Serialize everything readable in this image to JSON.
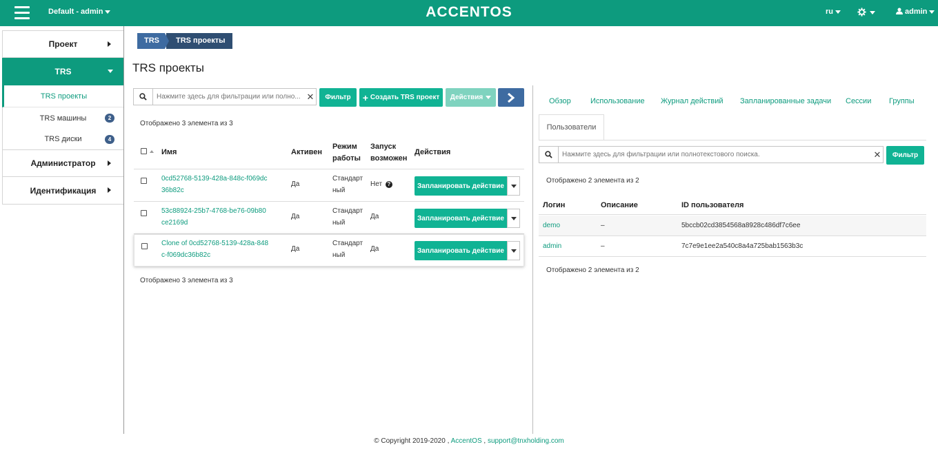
{
  "header": {
    "domain_selector": "Default - admin",
    "brand": "ACCENTOS",
    "language": "ru",
    "user": "admin",
    "colors": {
      "bar": "#0d9b7e",
      "accent": "#10b394",
      "breadcrumb": "#3e6ba1"
    }
  },
  "sidebar": {
    "items": [
      {
        "label": "Проект"
      },
      {
        "label": "TRS"
      },
      {
        "label": "Администратор"
      },
      {
        "label": "Идентификация"
      }
    ],
    "trs_sub": [
      {
        "label": "TRS проекты"
      },
      {
        "label": "TRS машины",
        "badge": "2"
      },
      {
        "label": "TRS диски",
        "badge": "4"
      }
    ]
  },
  "breadcrumb": [
    "TRS",
    "TRS проекты"
  ],
  "page_title": "TRS проекты",
  "left_panel": {
    "search_placeholder": "Нажмите здесь для фильтрации или полно...",
    "filter_button": "Фильтр",
    "create_button": "Создать TRS проект",
    "actions_button": "Действия",
    "count_top": "Отображено 3 элемента из 3",
    "count_bottom": "Отображено 3 элемента из 3",
    "columns": {
      "name": "Имя",
      "active": "Активен",
      "mode_1": "Режим",
      "mode_2": "работы",
      "launch_1": "Запуск",
      "launch_2": "возможен",
      "actions": "Действия"
    },
    "rows": [
      {
        "name_1": "0cd52768-5139-428a-848c-f069dc",
        "name_2": "36b82c",
        "active": "Да",
        "mode_1": "Стандарт",
        "mode_2": "ный",
        "launch": "Нет",
        "action": "Запланировать действие"
      },
      {
        "name_1": "53c88924-25b7-4768-be76-09b80",
        "name_2": "ce2169d",
        "active": "Да",
        "mode_1": "Стандарт",
        "mode_2": "ный",
        "launch": "Да",
        "action": "Запланировать действие"
      },
      {
        "name_1": "Clone of 0cd52768-5139-428a-848",
        "name_2": "c-f069dc36b82c",
        "active": "Да",
        "mode_1": "Стандарт",
        "mode_2": "ный",
        "launch": "Да",
        "action": "Запланировать действие"
      }
    ]
  },
  "right_panel": {
    "tabs": [
      "Обзор",
      "Использование",
      "Журнал действий",
      "Запланированные задачи",
      "Сессии",
      "Группы"
    ],
    "active_tab": "Пользователи",
    "search_placeholder": "Нажмите здесь для фильтрации или полнотекстового поиска.",
    "filter_button": "Фильтр",
    "count_top": "Отображено 2 элемента из 2",
    "count_bottom": "Отображено 2 элемента из 2",
    "columns": {
      "login": "Логин",
      "description": "Описание",
      "user_id": "ID пользователя"
    },
    "rows": [
      {
        "login": "demo",
        "description": "–",
        "user_id": "5bccb02cd3854568a8928c486df7c6ee"
      },
      {
        "login": "admin",
        "description": "–",
        "user_id": "7c7e9e1ee2a540c8a4a725bab1563b3c"
      }
    ]
  },
  "footer": {
    "copyright": "© Copyright 2019-2020 ,",
    "product": "AccentOS",
    "sep": ",",
    "email": "support@tnxholding.com"
  }
}
